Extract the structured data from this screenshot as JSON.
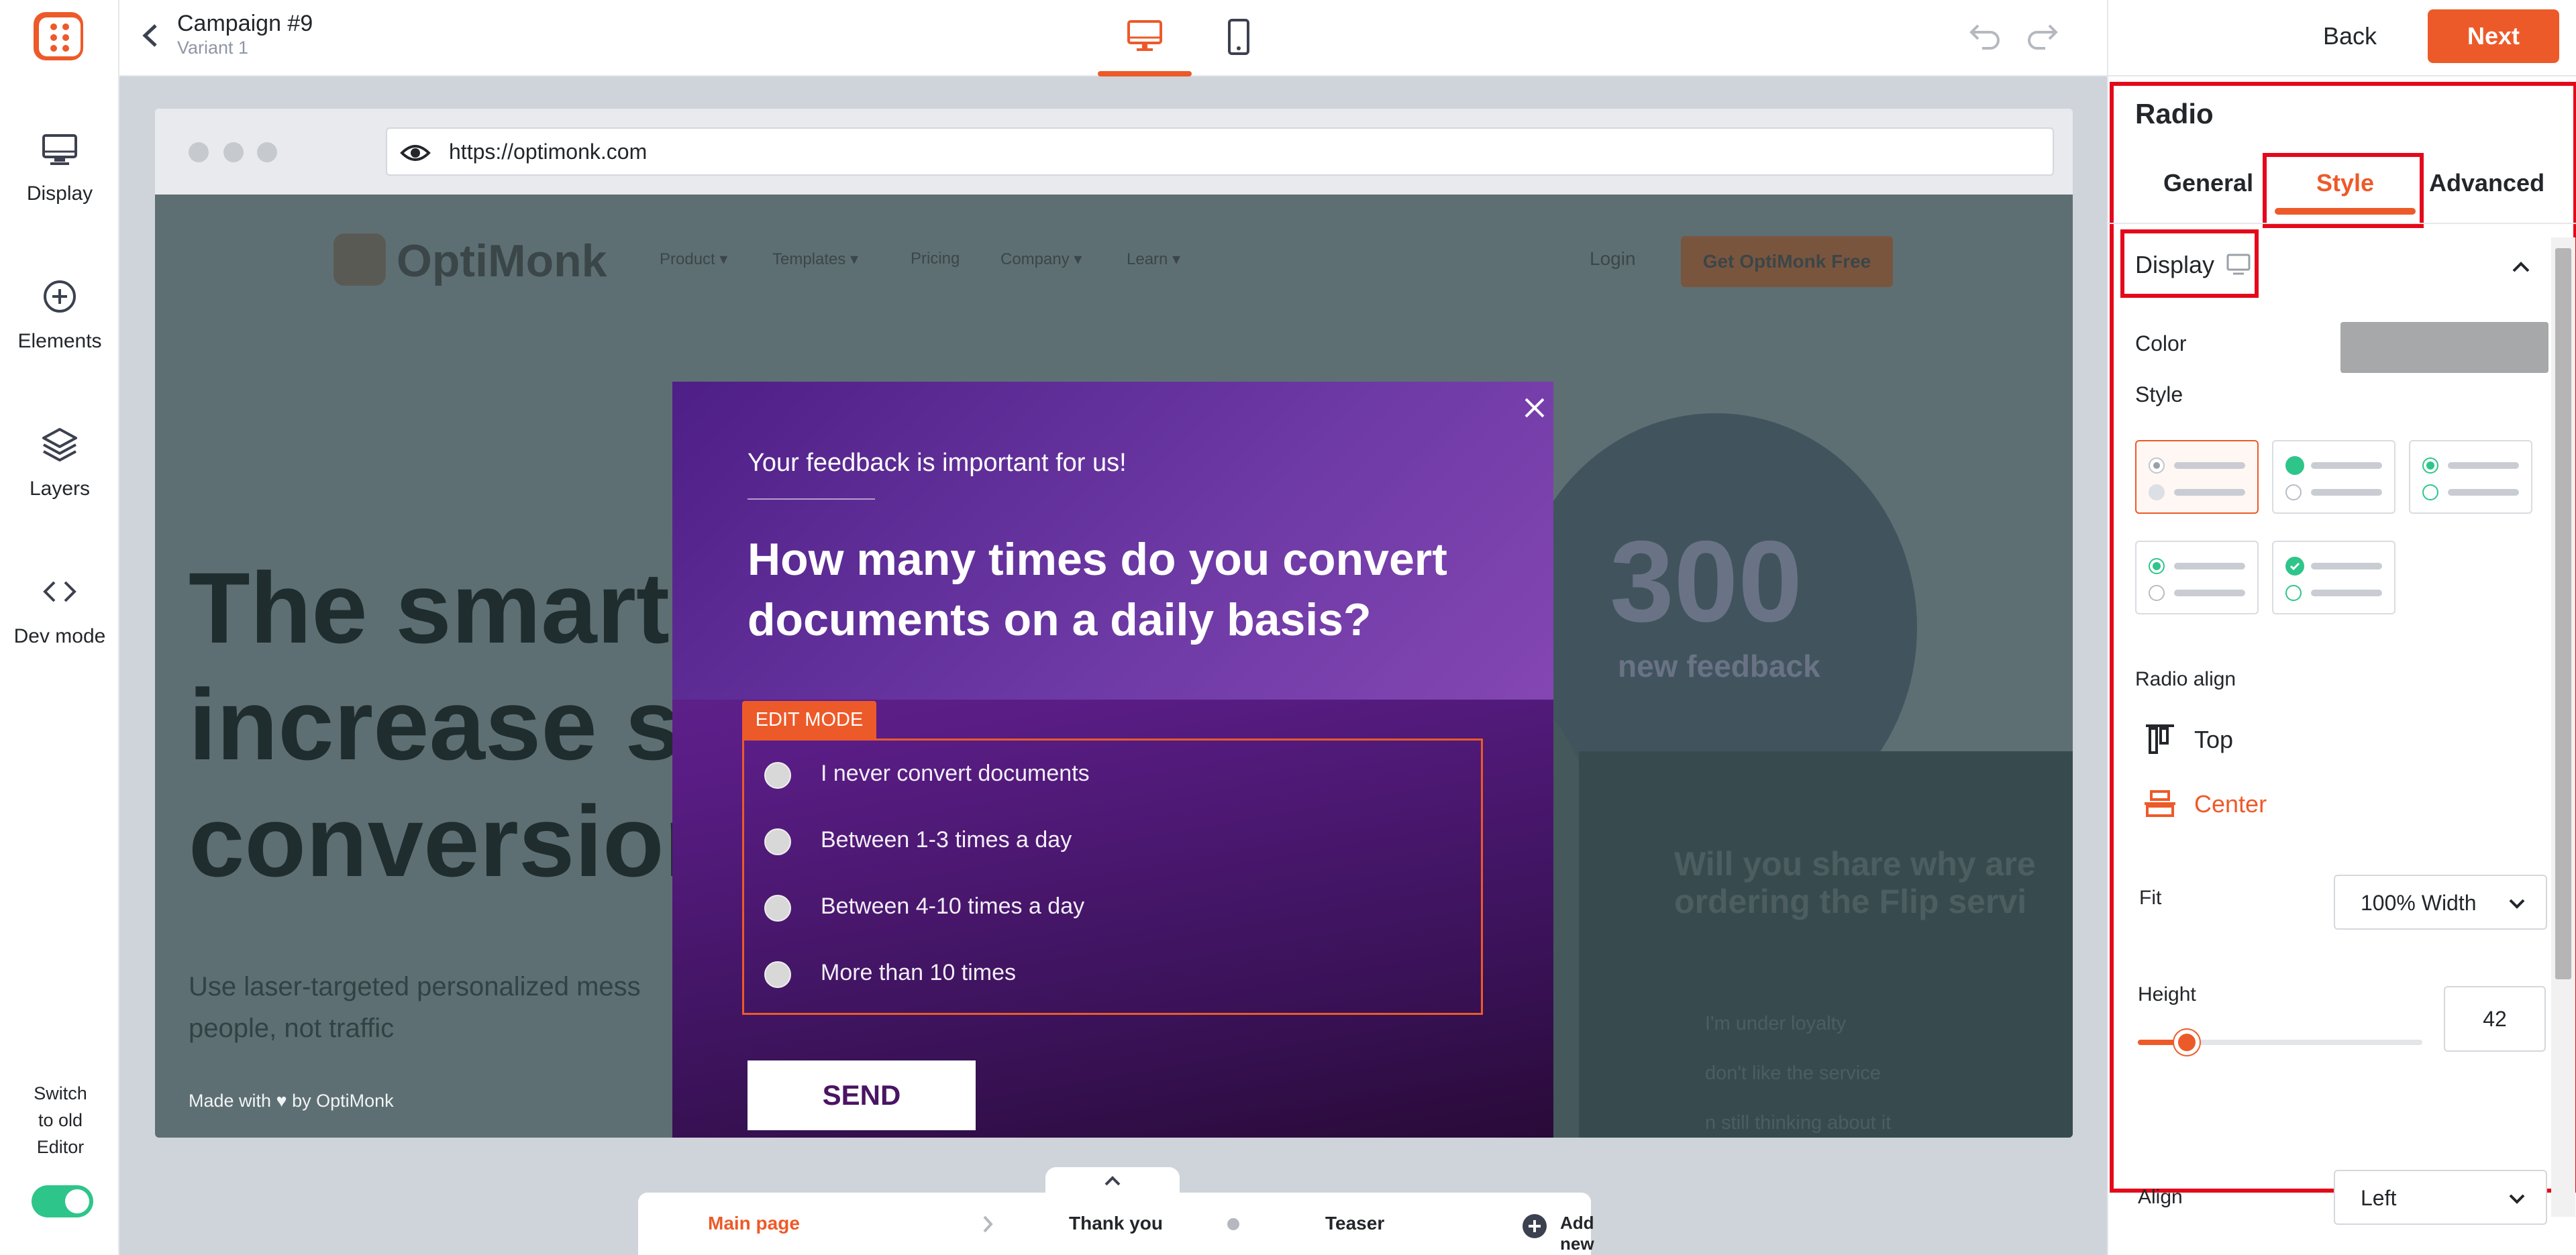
{
  "sidebar": {
    "items": [
      {
        "label": "Display",
        "icon": "monitor-icon"
      },
      {
        "label": "Elements",
        "icon": "plus-circle-icon"
      },
      {
        "label": "Layers",
        "icon": "layers-icon"
      },
      {
        "label": "Dev mode",
        "icon": "code-icon"
      }
    ],
    "switch_label_1": "Switch",
    "switch_label_2": "to old",
    "switch_label_3": "Editor",
    "switch_on": true
  },
  "header": {
    "campaign_title": "Campaign #9",
    "variant": "Variant 1",
    "back_label": "Back",
    "next_label": "Next"
  },
  "browser": {
    "url": "https://optimonk.com"
  },
  "site": {
    "logo": "OptiMonk",
    "nav": [
      "Product ▾",
      "Templates ▾",
      "Pricing",
      "Company ▾",
      "Learn ▾"
    ],
    "login": "Login",
    "cta": "Get OptiMonk Free",
    "hero_1": "The smarter",
    "hero_2": "increase sal",
    "hero_3": "conversions",
    "hero_sub_1": "Use laser-targeted personalized mess",
    "hero_sub_2": "people, not traffic",
    "stat_value": "300",
    "stat_label": "new feedback",
    "card_question_1": "Will you share why are",
    "card_question_2": "ordering the Flip servi",
    "card_options": [
      "I'm under loyalty",
      "don't like the service",
      "n still thinking about it"
    ],
    "made_with": "Made with ♥ by OptiMonk"
  },
  "popup": {
    "subtitle": "Your feedback is important for us!",
    "question_1": "How many times do you convert",
    "question_2": "documents on a daily basis?",
    "edit_mode": "EDIT MODE",
    "options": [
      "I never convert documents",
      "Between 1-3 times a day",
      "Between 4-10 times a day",
      "More than 10 times"
    ],
    "send_label": "SEND"
  },
  "pages": {
    "main": "Main page",
    "thank_you": "Thank you",
    "teaser": "Teaser",
    "add": "Add new page"
  },
  "panel": {
    "title": "Radio",
    "tabs": [
      "General",
      "Style",
      "Advanced"
    ],
    "active_tab": "Style",
    "section": "Display",
    "color_label": "Color",
    "color_value": "#a7a8aa",
    "style_label": "Style",
    "radio_align_label": "Radio align",
    "align_top": "Top",
    "align_center": "Center",
    "fit_label": "Fit",
    "fit_value": "100% Width",
    "height_label": "Height",
    "height_value": "42",
    "align_label": "Align",
    "align_value": "Left"
  },
  "colors": {
    "accent": "#ed5a29",
    "toggle_on": "#2ec58b",
    "highlight_box": "#e4091a",
    "popup_purple": "#5a1d86"
  }
}
